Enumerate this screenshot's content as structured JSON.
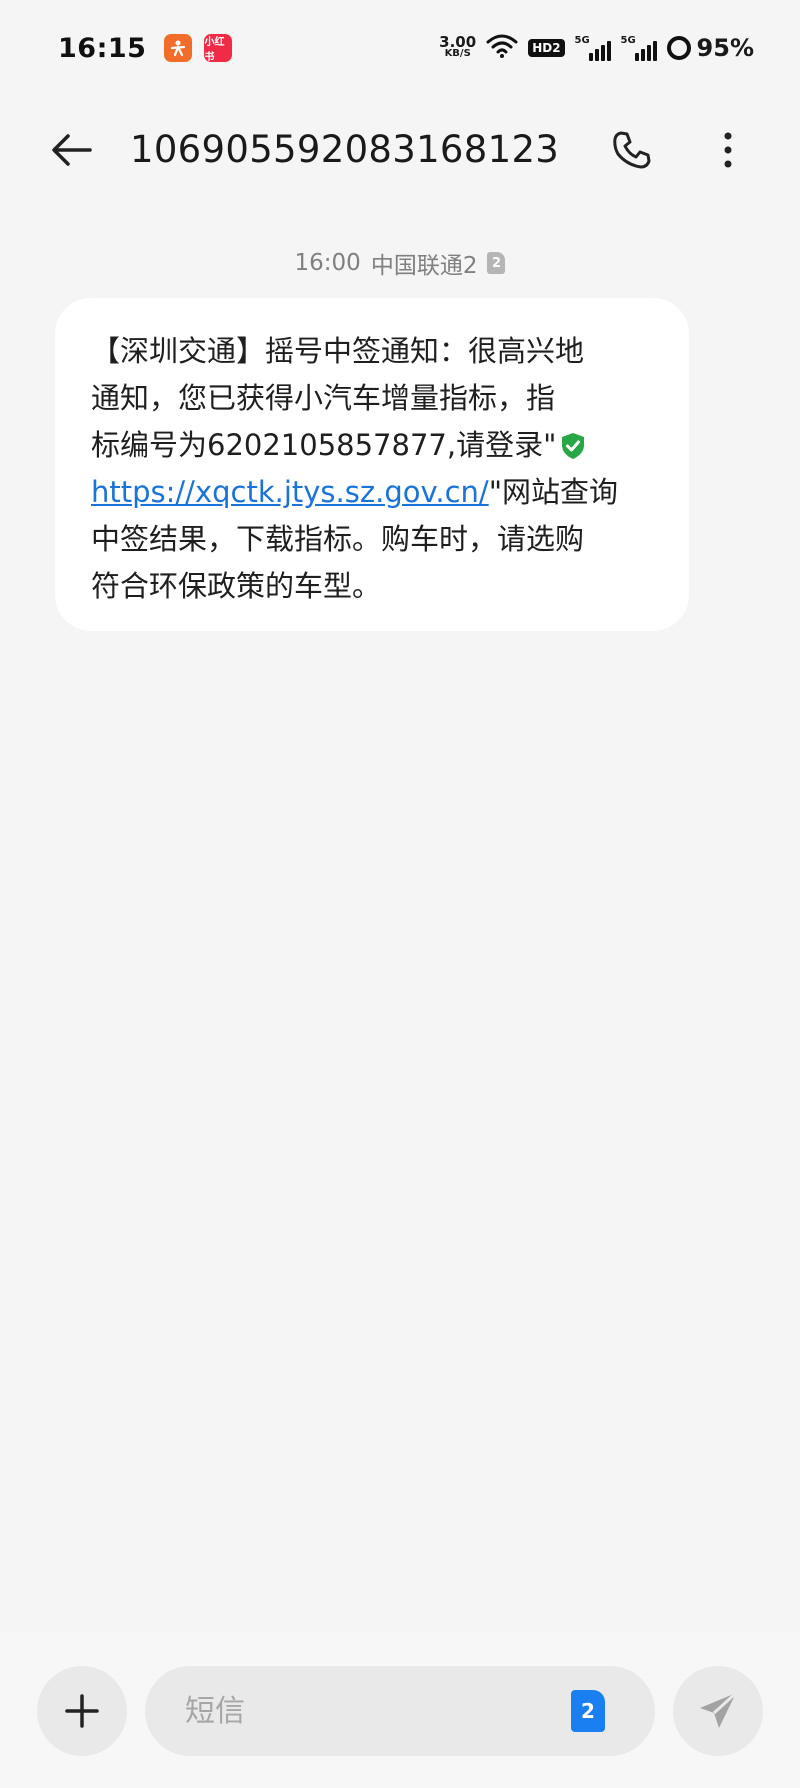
{
  "status_bar": {
    "time": "16:15",
    "apps": [
      {
        "icon": "app-orange-icon",
        "label": "",
        "color": "#f36d2a"
      },
      {
        "icon": "xiaohongshu-icon",
        "label": "小红书",
        "color": "#ef2b46"
      }
    ],
    "net_speed": "3.00",
    "net_speed_unit": "KB/S",
    "hd_label": "HD2",
    "signal1_label": "5G",
    "signal2_label": "5G",
    "battery": "95%"
  },
  "header": {
    "title": "1069055920831681​23",
    "back_icon": "arrow-left-icon",
    "call_icon": "phone-icon",
    "more_icon": "more-vertical-icon"
  },
  "message": {
    "time": "16:00",
    "carrier": "中国联通2",
    "sim_badge": "2",
    "lines": [
      "【深圳交通】摇号中签通知：很高兴地",
      "通知，您已获得小汽车增量指标，指",
      "标编号为6202105857877,请登录\""
    ],
    "link": "https://xqctk.jtys.sz.gov.cn/",
    "after_link": "\"网站查询",
    "lines_after": [
      "中签结果，下载指标。购车时，请选购",
      "符合环保政策的车型。"
    ],
    "verified_icon": "shield-check-icon",
    "verified_color": "#27a745"
  },
  "composer": {
    "placeholder": "短信",
    "sim_badge": "2",
    "sim_color": "#1a7ff0",
    "plus_icon": "plus-icon",
    "send_icon": "send-icon"
  }
}
